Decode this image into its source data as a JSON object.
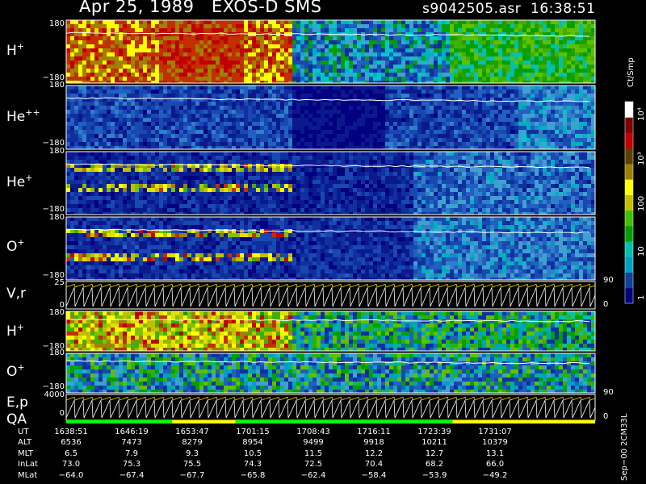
{
  "header": {
    "title_left": "Apr 25, 1989   EXOS-D SMS",
    "title_right": "s9042505.asr  16:38:51"
  },
  "colorbar": {
    "unit_label": "Ct/Smp",
    "ticks": [
      "10⁴",
      "10³",
      "100",
      "10",
      "1"
    ],
    "colors_bottom_to_top": [
      "#000080",
      "#1040a0",
      "#00a0c0",
      "#00c0b0",
      "#00a000",
      "#40c000",
      "#c0c000",
      "#ffff00",
      "#a08000",
      "#604000",
      "#c00000",
      "#800000",
      "#ffffff"
    ]
  },
  "panels": {
    "p1": {
      "label": "H",
      "sup": "+",
      "ymax": "180",
      "ymin": "−180"
    },
    "p2": {
      "label": "He",
      "sup": "++",
      "ymax": "180",
      "ymin": "−180"
    },
    "p3": {
      "label": "He",
      "sup": "+",
      "ymax": "180",
      "ymin": "−180"
    },
    "p4": {
      "label": "O",
      "sup": "+",
      "ymax": "180",
      "ymin": "−180"
    },
    "p5": {
      "label": "V,r",
      "ymax": "25",
      "ymin": "0",
      "rmax": "90",
      "rmin": "0"
    },
    "p6": {
      "label": "H",
      "sup": "+",
      "ymax": "180",
      "ymin": "−180"
    },
    "p7": {
      "label": "O",
      "sup": "+",
      "ymax": "180",
      "ymin": "−180"
    },
    "p8": {
      "label": "E,p",
      "ymax": "4000",
      "ymin": "0",
      "rmax": "90",
      "rmin": "0"
    },
    "p9": {
      "label": "QA"
    }
  },
  "footer": {
    "rows": [
      {
        "label": "UT",
        "values": [
          "1638:51",
          "1646:19",
          "1653:47",
          "1701:15",
          "1708:43",
          "1716:11",
          "1723:39",
          "1731:07"
        ]
      },
      {
        "label": "ALT",
        "values": [
          "6536",
          "7473",
          "8279",
          "8954",
          "9499",
          "9918",
          "10211",
          "10379"
        ]
      },
      {
        "label": "MLT",
        "values": [
          "6.5",
          "7.9",
          "9.3",
          "10.5",
          "11.5",
          "12.2",
          "12.7",
          "13.1"
        ]
      },
      {
        "label": "InLat",
        "values": [
          "73.0",
          "75.3",
          "75.5",
          "74.3",
          "72.5",
          "70.4",
          "68.2",
          "66.0"
        ]
      },
      {
        "label": "MLat",
        "values": [
          "−64.0",
          "−67.4",
          "−67.7",
          "−65.8",
          "−62.4",
          "−58.4",
          "−53.9",
          "−49.2"
        ]
      }
    ],
    "side_note": "Sep−00  2CM33L"
  },
  "chart_data": {
    "type": "heatmap",
    "title": "Apr 25, 1989   EXOS-D SMS",
    "x_label": "UT",
    "x_ticks": [
      "1638:51",
      "1646:19",
      "1653:47",
      "1701:15",
      "1708:43",
      "1716:11",
      "1723:39",
      "1731:07"
    ],
    "color_scale": "log",
    "color_unit": "Ct/Smp",
    "color_range": [
      1,
      10000
    ],
    "spectrograms": [
      {
        "name": "H+",
        "ylim": [
          -180,
          180
        ]
      },
      {
        "name": "He++",
        "ylim": [
          -180,
          180
        ]
      },
      {
        "name": "He+",
        "ylim": [
          -180,
          180
        ]
      },
      {
        "name": "O+",
        "ylim": [
          -180,
          180
        ]
      },
      {
        "name": "H+",
        "ylim": [
          -180,
          180
        ]
      },
      {
        "name": "O+",
        "ylim": [
          -180,
          180
        ]
      }
    ],
    "line_panels": [
      {
        "name": "V,r",
        "ylim": [
          0,
          25
        ],
        "right_ylim": [
          0,
          90
        ]
      },
      {
        "name": "E,p",
        "ylim": [
          0,
          4000
        ],
        "right_ylim": [
          0,
          90
        ]
      }
    ]
  }
}
